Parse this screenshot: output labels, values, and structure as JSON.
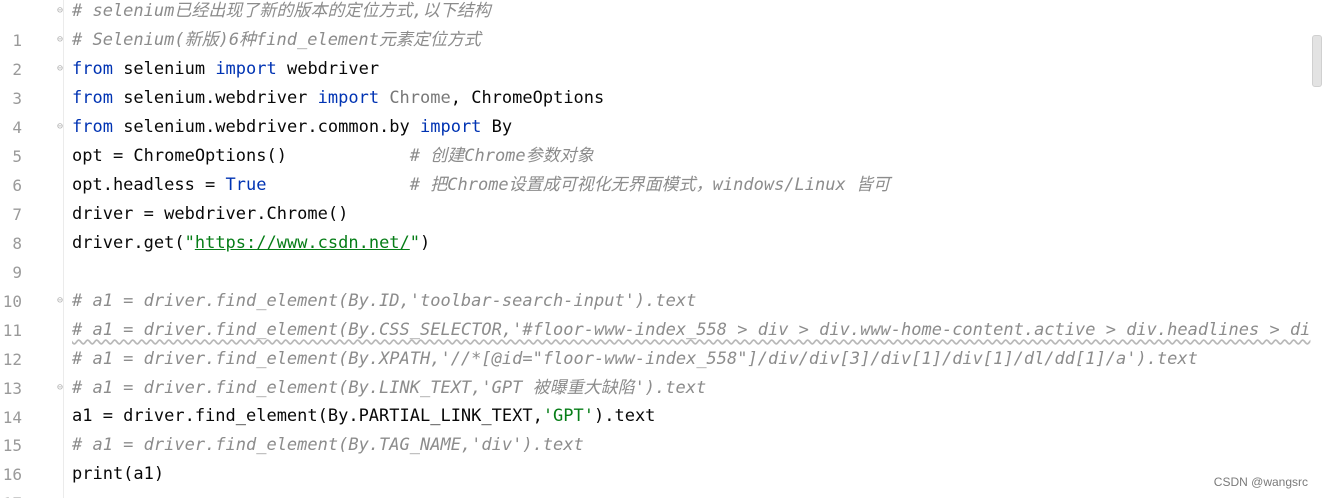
{
  "lines": [
    {
      "no": "1",
      "code": "# selenium已经出现了新的版本的定位方式,以下结构"
    },
    {
      "no": "2",
      "code": "# Selenium(新版)6种find_element元素定位方式"
    },
    {
      "no": "3",
      "kw1": "from",
      "mod": " selenium ",
      "kw2": "import",
      "name": " webdriver"
    },
    {
      "no": "4",
      "kw1": "from",
      "mod": " selenium.webdriver ",
      "kw2": "import",
      "unused": " Chrome",
      "rest": ", ChromeOptions"
    },
    {
      "no": "5",
      "kw1": "from",
      "mod": " selenium.webdriver.common.by ",
      "kw2": "import",
      "name": " By"
    },
    {
      "no": "6",
      "code": "opt = ChromeOptions()            ",
      "comment": "# 创建Chrome参数对象"
    },
    {
      "no": "7",
      "code": "opt.headless = ",
      "bool": "True",
      "pad": "              ",
      "comment": "# 把Chrome设置成可视化无界面模式，windows/Linux 皆可"
    },
    {
      "no": "8",
      "code": "driver = webdriver.Chrome()"
    },
    {
      "no": "9",
      "pre": "driver.get(",
      "q1": "\"",
      "url": "https://www.csdn.net/",
      "q2": "\"",
      "post": ")"
    },
    {
      "no": "10",
      "code": ""
    },
    {
      "no": "11",
      "comment": "# a1 = driver.find_element(By.ID,'toolbar-search-input').text"
    },
    {
      "no": "12",
      "comment": "# a1 = driver.find_element(By.CSS_SELECTOR,'#floor-www-index_558 > div > div.www-home-content.active > div.headlines > di"
    },
    {
      "no": "13",
      "comment": "# a1 = driver.find_element(By.XPATH,'//*[@id=\"floor-www-index_558\"]/div/div[3]/div[1]/div[1]/dl/dd[1]/a').text"
    },
    {
      "no": "14",
      "comment": "# a1 = driver.find_element(By.LINK_TEXT,'GPT 被曝重大缺陷').text"
    },
    {
      "no": "15",
      "pre": "a1 = driver.find_element(By.PARTIAL_LINK_TEXT,",
      "str": "'GPT'",
      "post": ").text"
    },
    {
      "no": "16",
      "comment": "# a1 = driver.find_element(By.TAG_NAME,'div').text"
    },
    {
      "no": "17",
      "pre": "print(a1)"
    }
  ],
  "watermark": "CSDN @wangsrc",
  "colors": {
    "keyword": "#0033b3",
    "comment": "#8c8c8c",
    "string": "#067d17",
    "text": "#080808"
  }
}
